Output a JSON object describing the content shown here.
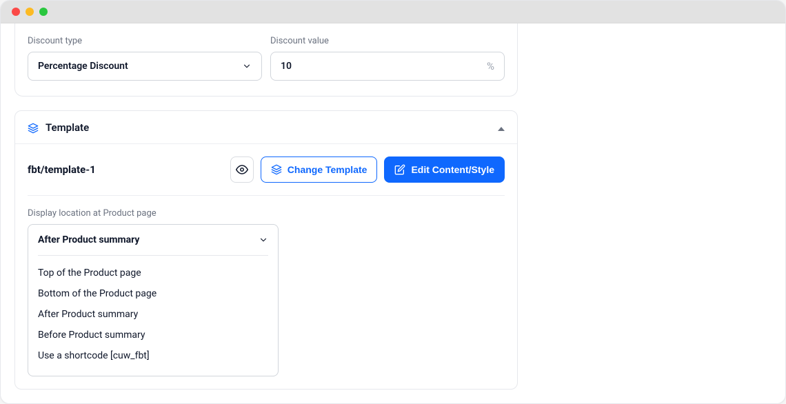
{
  "discount": {
    "type_label": "Discount type",
    "type_value": "Percentage Discount",
    "value_label": "Discount value",
    "value": "10",
    "suffix": "%"
  },
  "template": {
    "section_title": "Template",
    "path": "fbt/template-1",
    "change_label": "Change Template",
    "edit_label": "Edit Content/Style"
  },
  "location": {
    "label": "Display location at Product page",
    "selected": "After Product summary",
    "options": [
      "Top of the  Product page",
      "Bottom of the  Product page",
      "After Product summary",
      "Before Product summary",
      "Use a shortcode [cuw_fbt]"
    ]
  }
}
